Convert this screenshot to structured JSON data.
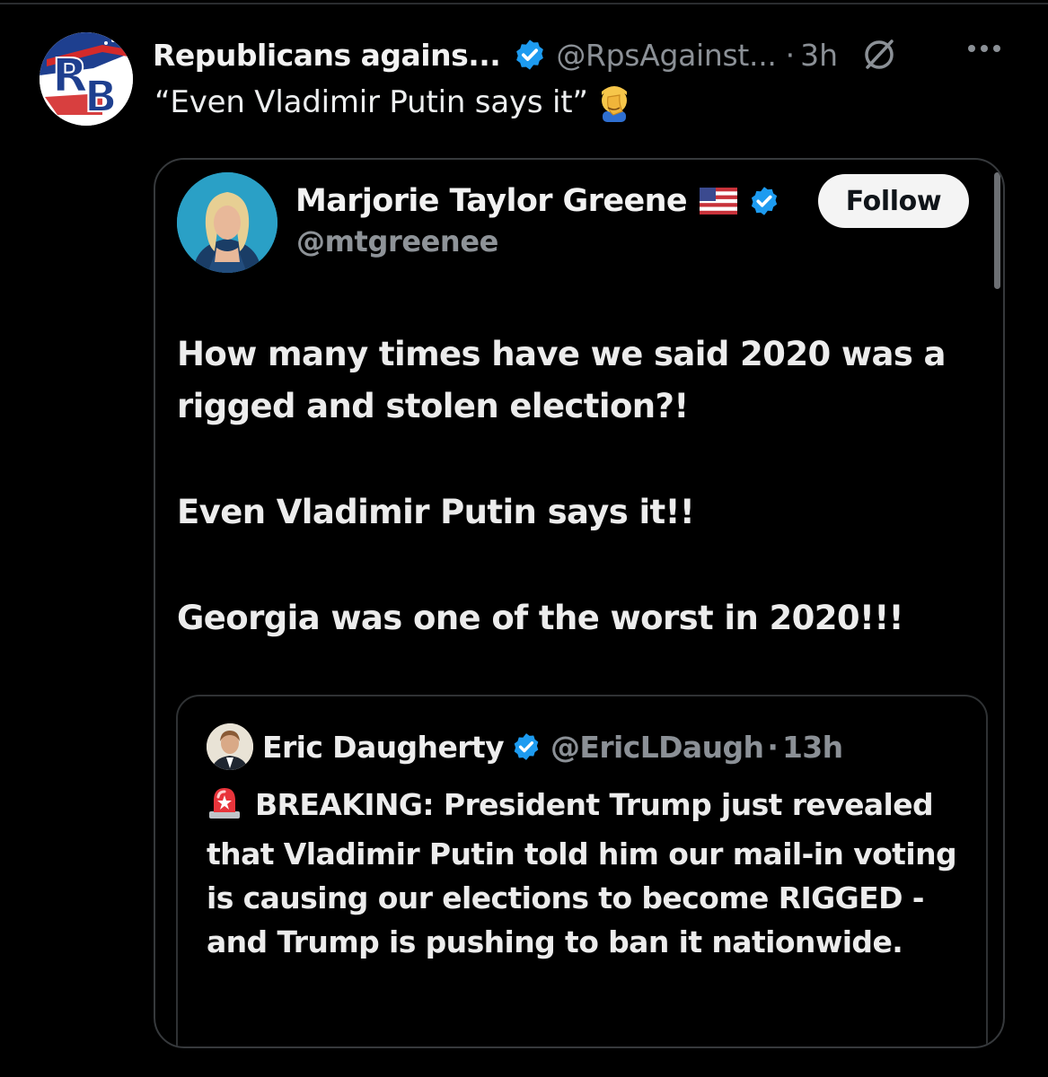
{
  "post": {
    "author_name": "Republicans agains...",
    "handle": "@RpsAgainst...",
    "separator": "·",
    "time": "3h",
    "text": "“Even Vladimir Putin says it”",
    "avatar_letters": {
      "r": "R",
      "b": "B"
    }
  },
  "quote": {
    "author_name": "Marjorie Taylor Greene",
    "handle": "@mtgreenee",
    "follow_label": "Follow",
    "paragraphs": [
      "How many times have we said 2020 was a rigged and stolen election?!",
      "Even Vladimir Putin says it!!",
      "Georgia was one of the worst in 2020!!!"
    ]
  },
  "nested_quote": {
    "author_name": "Eric Daugherty",
    "handle": "@EricLDaugh",
    "separator": "·",
    "time": "13h",
    "text": "BREAKING: President Trump just revealed that Vladimir Putin told him our mail-in voting is causing our elections to become RIGGED - and Trump is pushing to ban it nationwide."
  },
  "icons": {
    "verified": "verified-badge-icon",
    "grok": "grok-icon",
    "more": "more-icon",
    "flag": "us-flag-icon",
    "facepalm": "facepalm-emoji-icon",
    "siren": "siren-emoji-icon"
  },
  "colors": {
    "background": "#000000",
    "verified_blue": "#1d9bf0",
    "secondary_text": "#8b9096",
    "card_border": "#36393c"
  }
}
